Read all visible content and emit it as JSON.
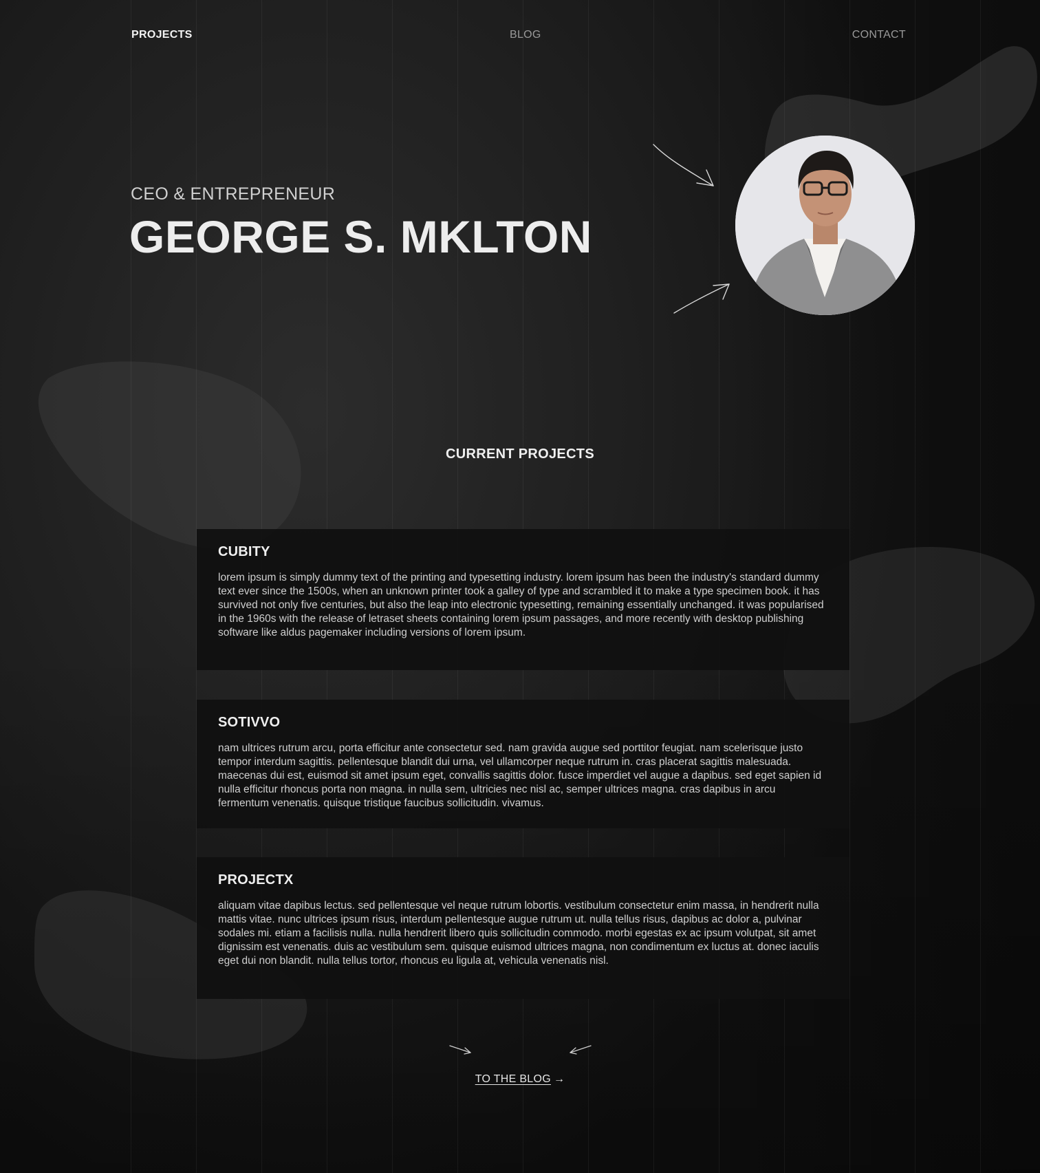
{
  "nav": {
    "projects": "PROJECTS",
    "blog": "BLOG",
    "contact": "CONTACT"
  },
  "hero": {
    "subtitle": "CEO & ENTREPRENEUR",
    "name": "GEORGE S. MKLTON"
  },
  "projects": {
    "title": "CURRENT PROJECTS",
    "items": [
      {
        "name": "CUBITY",
        "description": "lorem ipsum is simply dummy text of the printing and typesetting industry. lorem ipsum has been the industry's standard dummy text ever since the 1500s, when an unknown printer took a galley of type and scrambled it to make a type specimen book. it has survived not only five centuries, but also the leap into electronic typesetting, remaining essentially unchanged. it was popularised in the 1960s with the release of letraset sheets containing lorem ipsum passages, and more recently with desktop publishing software like aldus pagemaker including versions of lorem ipsum."
      },
      {
        "name": "SOTIVVO",
        "description": "nam ultrices rutrum arcu, porta efficitur ante consectetur sed. nam gravida augue sed porttitor feugiat. nam scelerisque justo tempor interdum sagittis. pellentesque blandit dui urna, vel ullamcorper neque rutrum in. cras placerat sagittis malesuada. maecenas dui est, euismod sit amet ipsum eget, convallis sagittis dolor. fusce imperdiet vel augue a dapibus. sed eget sapien id nulla efficitur rhoncus porta non magna. in nulla sem, ultricies nec nisl ac, semper ultrices magna. cras dapibus in arcu fermentum venenatis. quisque tristique faucibus sollicitudin. vivamus."
      },
      {
        "name": "PROJECTX",
        "description": "aliquam vitae dapibus lectus. sed pellentesque vel neque rutrum lobortis. vestibulum consectetur enim massa, in hendrerit nulla mattis vitae. nunc ultrices ipsum risus, interdum pellentesque augue rutrum ut. nulla tellus risus, dapibus ac dolor a, pulvinar sodales mi. etiam a facilisis nulla. nulla hendrerit libero quis sollicitudin commodo. morbi egestas ex ac ipsum volutpat, sit amet dignissim est venenatis. duis ac vestibulum sem. quisque euismod ultrices magna, non condimentum ex luctus at. donec iaculis eget dui non blandit. nulla tellus tortor, rhoncus eu ligula at, vehicula venenatis nisl."
      }
    ]
  },
  "cta": {
    "label": "TO THE BLOG",
    "arrow": "→"
  },
  "icons": {
    "avatar": "profile-photo",
    "doodle": "hand-drawn-arrow-icon"
  },
  "colors": {
    "background": "#1b1b1b",
    "card": "#101010",
    "text": "#e8e8e8",
    "muted": "#9a9a9a"
  }
}
